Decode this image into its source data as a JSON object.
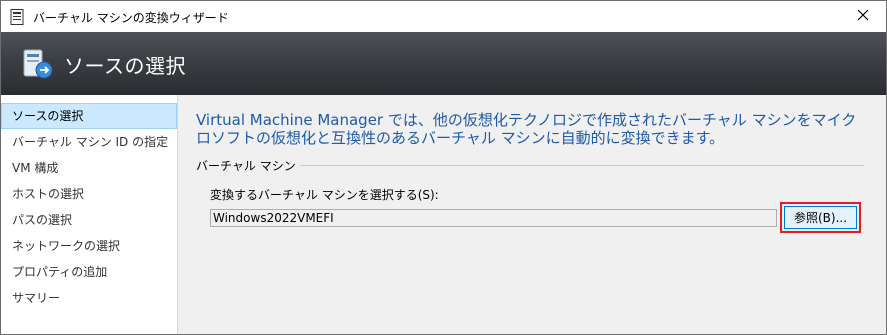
{
  "window": {
    "title": "バーチャル マシンの変換ウィザード"
  },
  "banner": {
    "title": "ソースの選択"
  },
  "sidebar": {
    "items": [
      {
        "label": "ソースの選択",
        "selected": true
      },
      {
        "label": "バーチャル マシン ID の指定",
        "selected": false
      },
      {
        "label": "VM 構成",
        "selected": false
      },
      {
        "label": "ホストの選択",
        "selected": false
      },
      {
        "label": "パスの選択",
        "selected": false
      },
      {
        "label": "ネットワークの選択",
        "selected": false
      },
      {
        "label": "プロパティの追加",
        "selected": false
      },
      {
        "label": "サマリー",
        "selected": false
      }
    ]
  },
  "main": {
    "description": "Virtual Machine Manager では、他の仮想化テクノロジで作成されたバーチャル マシンをマイクロソフトの仮想化と互換性のあるバーチャル マシンに自動的に変換できます。",
    "group_label": "バーチャル マシン",
    "field_label": "変換するバーチャル マシンを選択する(S):",
    "vm_value": "Windows2022VMEFI",
    "browse_label": "参照(B)..."
  },
  "colors": {
    "description_text": "#1e5aa8",
    "selection_bg": "#cce8ff",
    "highlight_box": "#e02020"
  },
  "icons": {
    "app": "document-icon",
    "banner": "vm-convert-icon",
    "close": "close-icon"
  }
}
